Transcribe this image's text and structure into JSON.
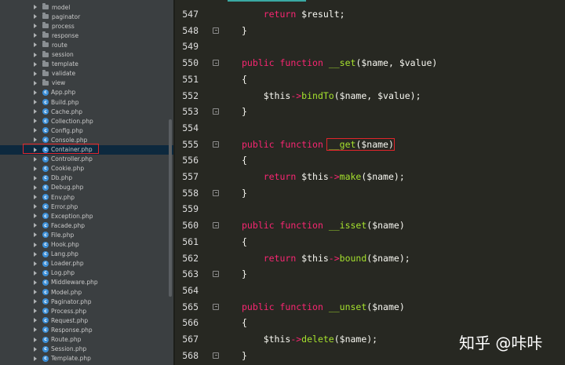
{
  "sidebar": {
    "items": [
      {
        "label": "model",
        "kind": "folder"
      },
      {
        "label": "paginator",
        "kind": "folder"
      },
      {
        "label": "process",
        "kind": "folder"
      },
      {
        "label": "response",
        "kind": "folder"
      },
      {
        "label": "route",
        "kind": "folder"
      },
      {
        "label": "session",
        "kind": "folder"
      },
      {
        "label": "template",
        "kind": "folder"
      },
      {
        "label": "validate",
        "kind": "folder"
      },
      {
        "label": "view",
        "kind": "folder"
      },
      {
        "label": "App.php",
        "kind": "file"
      },
      {
        "label": "Build.php",
        "kind": "file"
      },
      {
        "label": "Cache.php",
        "kind": "file"
      },
      {
        "label": "Collection.php",
        "kind": "file"
      },
      {
        "label": "Config.php",
        "kind": "file"
      },
      {
        "label": "Console.php",
        "kind": "file"
      },
      {
        "label": "Container.php",
        "kind": "file",
        "selected": true
      },
      {
        "label": "Controller.php",
        "kind": "file"
      },
      {
        "label": "Cookie.php",
        "kind": "file"
      },
      {
        "label": "Db.php",
        "kind": "file"
      },
      {
        "label": "Debug.php",
        "kind": "file"
      },
      {
        "label": "Env.php",
        "kind": "file"
      },
      {
        "label": "Error.php",
        "kind": "file"
      },
      {
        "label": "Exception.php",
        "kind": "file"
      },
      {
        "label": "Facade.php",
        "kind": "file"
      },
      {
        "label": "File.php",
        "kind": "file"
      },
      {
        "label": "Hook.php",
        "kind": "file"
      },
      {
        "label": "Lang.php",
        "kind": "file"
      },
      {
        "label": "Loader.php",
        "kind": "file"
      },
      {
        "label": "Log.php",
        "kind": "file"
      },
      {
        "label": "Middleware.php",
        "kind": "file"
      },
      {
        "label": "Model.php",
        "kind": "file"
      },
      {
        "label": "Paginator.php",
        "kind": "file"
      },
      {
        "label": "Process.php",
        "kind": "file"
      },
      {
        "label": "Request.php",
        "kind": "file"
      },
      {
        "label": "Response.php",
        "kind": "file"
      },
      {
        "label": "Route.php",
        "kind": "file"
      },
      {
        "label": "Session.php",
        "kind": "file"
      },
      {
        "label": "Template.php",
        "kind": "file"
      }
    ],
    "file_icon_glyph": "c"
  },
  "editor": {
    "lines": [
      {
        "num": "547",
        "gutter": false,
        "tokens": [
          {
            "t": "    "
          },
          {
            "t": "return",
            "c": "kw"
          },
          {
            "t": " $result;"
          }
        ]
      },
      {
        "num": "548",
        "gutter": true,
        "tokens": [
          {
            "t": "}"
          }
        ]
      },
      {
        "num": "549",
        "gutter": false,
        "tokens": []
      },
      {
        "num": "550",
        "gutter": true,
        "tokens": [
          {
            "t": "public",
            "c": "kw"
          },
          {
            "t": " "
          },
          {
            "t": "function",
            "c": "kw"
          },
          {
            "t": " "
          },
          {
            "t": "__set",
            "c": "fn"
          },
          {
            "t": "($name, $value)"
          }
        ]
      },
      {
        "num": "551",
        "gutter": false,
        "tokens": [
          {
            "t": "{"
          }
        ]
      },
      {
        "num": "552",
        "gutter": false,
        "tokens": [
          {
            "t": "    $this"
          },
          {
            "t": "->",
            "c": "op"
          },
          {
            "t": "bindTo",
            "c": "fn"
          },
          {
            "t": "($name, $value);"
          }
        ]
      },
      {
        "num": "553",
        "gutter": true,
        "tokens": [
          {
            "t": "}"
          }
        ]
      },
      {
        "num": "554",
        "gutter": false,
        "tokens": []
      },
      {
        "num": "555",
        "gutter": true,
        "tokens": [
          {
            "t": "public",
            "c": "kw"
          },
          {
            "t": " "
          },
          {
            "t": "function",
            "c": "kw"
          },
          {
            "t": " "
          },
          {
            "t": "__get",
            "c": "fn"
          },
          {
            "t": "($name)"
          }
        ]
      },
      {
        "num": "556",
        "gutter": false,
        "tokens": [
          {
            "t": "{"
          }
        ]
      },
      {
        "num": "557",
        "gutter": false,
        "tokens": [
          {
            "t": "    "
          },
          {
            "t": "return",
            "c": "kw"
          },
          {
            "t": " $this"
          },
          {
            "t": "->",
            "c": "op"
          },
          {
            "t": "make",
            "c": "fn"
          },
          {
            "t": "($name);"
          }
        ]
      },
      {
        "num": "558",
        "gutter": true,
        "tokens": [
          {
            "t": "}"
          }
        ]
      },
      {
        "num": "559",
        "gutter": false,
        "tokens": []
      },
      {
        "num": "560",
        "gutter": true,
        "tokens": [
          {
            "t": "public",
            "c": "kw"
          },
          {
            "t": " "
          },
          {
            "t": "function",
            "c": "kw"
          },
          {
            "t": " "
          },
          {
            "t": "__isset",
            "c": "fn"
          },
          {
            "t": "($name)"
          }
        ]
      },
      {
        "num": "561",
        "gutter": false,
        "tokens": [
          {
            "t": "{"
          }
        ]
      },
      {
        "num": "562",
        "gutter": false,
        "tokens": [
          {
            "t": "    "
          },
          {
            "t": "return",
            "c": "kw"
          },
          {
            "t": " $this"
          },
          {
            "t": "->",
            "c": "op"
          },
          {
            "t": "bound",
            "c": "fn"
          },
          {
            "t": "($name);"
          }
        ]
      },
      {
        "num": "563",
        "gutter": true,
        "tokens": [
          {
            "t": "}"
          }
        ]
      },
      {
        "num": "564",
        "gutter": false,
        "tokens": []
      },
      {
        "num": "565",
        "gutter": true,
        "tokens": [
          {
            "t": "public",
            "c": "kw"
          },
          {
            "t": " "
          },
          {
            "t": "function",
            "c": "kw"
          },
          {
            "t": " "
          },
          {
            "t": "__unset",
            "c": "fn"
          },
          {
            "t": "($name)"
          }
        ]
      },
      {
        "num": "566",
        "gutter": false,
        "tokens": [
          {
            "t": "{"
          }
        ]
      },
      {
        "num": "567",
        "gutter": false,
        "tokens": [
          {
            "t": "    $this"
          },
          {
            "t": "->",
            "c": "op"
          },
          {
            "t": "delete",
            "c": "fn"
          },
          {
            "t": "($name);"
          }
        ]
      },
      {
        "num": "568",
        "gutter": true,
        "tokens": [
          {
            "t": "}"
          }
        ]
      }
    ]
  },
  "watermark": "知乎 @咔咔",
  "colors": {
    "editor_bg": "#272822",
    "sidebar_bg": "#3b3f41",
    "keyword": "#f92672",
    "function": "#a6e22e",
    "highlight_box": "#e0252b"
  }
}
